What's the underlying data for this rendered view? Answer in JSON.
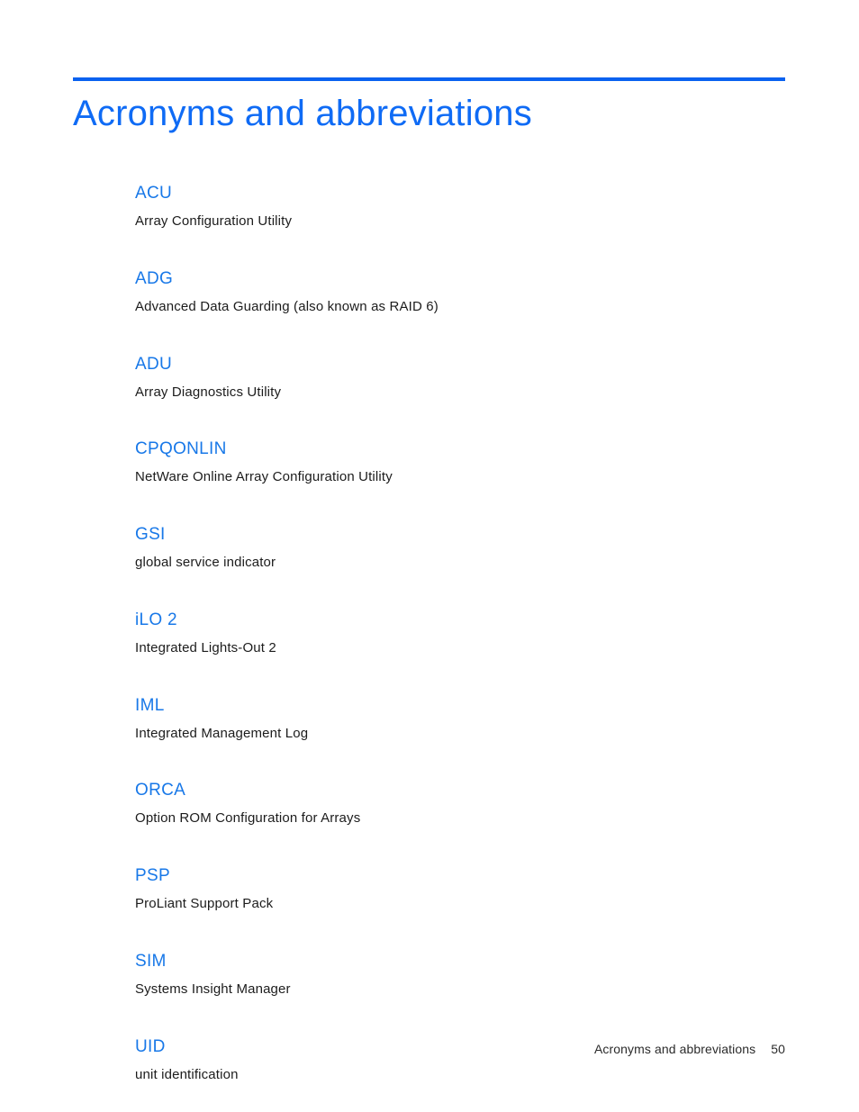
{
  "document": {
    "title": "Acronyms and abbreviations",
    "accent_color": "#0a62f0",
    "heading_color": "#0f6bf5",
    "term_color": "#1878e8",
    "body_color": "#1c1c1c",
    "background_color": "#ffffff"
  },
  "glossary": {
    "entries": [
      {
        "term": "ACU",
        "definition": "Array Configuration Utility"
      },
      {
        "term": "ADG",
        "definition": "Advanced Data Guarding (also known as RAID 6)"
      },
      {
        "term": "ADU",
        "definition": "Array Diagnostics Utility"
      },
      {
        "term": "CPQONLIN",
        "definition": "NetWare Online Array Configuration Utility"
      },
      {
        "term": "GSI",
        "definition": "global service indicator"
      },
      {
        "term": "iLO 2",
        "definition": "Integrated Lights-Out 2"
      },
      {
        "term": "IML",
        "definition": "Integrated Management Log"
      },
      {
        "term": "ORCA",
        "definition": "Option ROM Configuration for Arrays"
      },
      {
        "term": "PSP",
        "definition": "ProLiant Support Pack"
      },
      {
        "term": "SIM",
        "definition": "Systems Insight Manager"
      },
      {
        "term": "UID",
        "definition": "unit identification"
      }
    ]
  },
  "footer": {
    "label": "Acronyms and abbreviations",
    "page_number": "50"
  }
}
